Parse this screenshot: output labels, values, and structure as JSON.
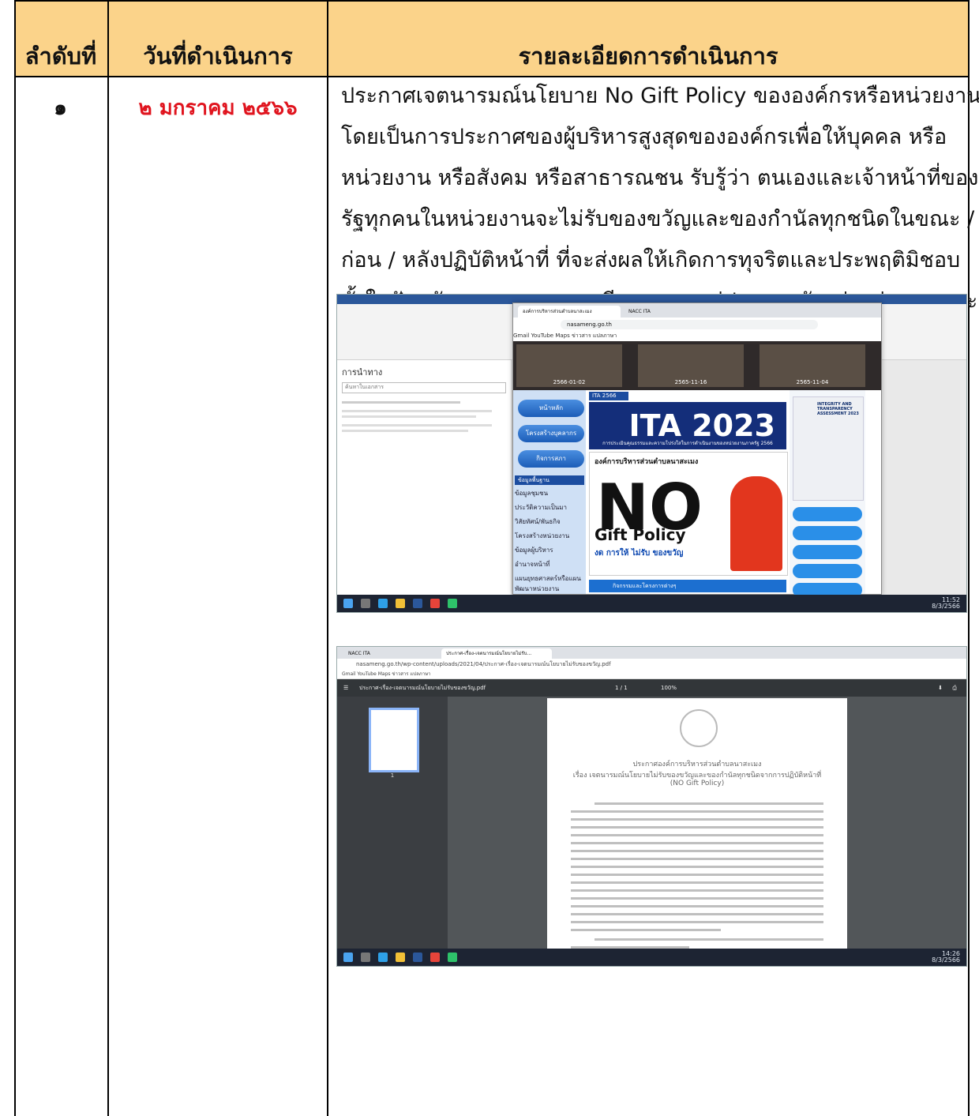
{
  "table": {
    "headers": [
      "ลำดับที่",
      "วันที่ดำเนินการ",
      "รายละเอียดการดำเนินการ"
    ],
    "header_color": "#fbd38a",
    "rows": [
      {
        "number": "๑",
        "date": "๒ มกราคม ๒๕๖๖",
        "date_color": "#e0141e",
        "details_lines": [
          "ประกาศเจตนารมณ์นโยบาย No Gift Policy ขององค์กรหรือหน่วยงาน",
          "โดยเป็นการประกาศของผู้บริหารสูงสุดขององค์กรเพื่อให้บุคคล หรือ",
          "หน่วยงาน หรือสังคม หรือสาธารณชน รับรู้ว่า ตนเองและเจ้าหน้าที่ของ",
          "รัฐทุกคนในหน่วยงานจะไม่รับของขวัญและของกำนัลทุกชนิดในขณะ /",
          "ก่อน / หลังปฏิบัติหน้าที่ ที่จะส่งผลให้เกิดการทุจริตและประพฤติมิชอบ",
          "ทั้งในปัจจุบันและอนาคตและมีการเผยแพร่ประกาศดังกล่าวสู่สาธารณะ"
        ]
      }
    ]
  },
  "screenshot1": {
    "word_nav_title": "การนำทาง",
    "word_nav_search": "ค้นหาในเอกสาร",
    "browser_tab_1": "องค์การบริหารส่วนตำบลนาสะเมง",
    "browser_tab_2": "NACC ITA",
    "address": "nasameng.go.th",
    "bookmarks": "Gmail   YouTube   Maps   ข่าวสาร   แปลภาษา",
    "news_dates": [
      "2566-01-02",
      "2565-11-16",
      "2565-11-04"
    ],
    "menu_buttons": [
      "หน้าหลัก",
      "โครงสร้างบุคลากร",
      "กิจการสภา"
    ],
    "menu_heading": "ข้อมูลพื้นฐาน",
    "menu_links": [
      "ข้อมูลชุมชน",
      "ประวัติความเป็นมา",
      "วิสัยทัศน์/พันธกิจ",
      "โครงสร้างหน่วยงาน",
      "ข้อมูลผู้บริหาร",
      "อำนาจหน้าที่",
      "แผนยุทธศาสตร์หรือแผนพัฒนาหน่วยงาน"
    ],
    "ita_label": "ITA 2566",
    "ita_title": "ITA 2023",
    "ita_sub": "การประเมินคุณธรรมและความโปร่งใสในการดำเนินงานของหน่วยงานภาครัฐ 2566",
    "org_name": "องค์การบริหารส่วนตำบลนาสะเมง",
    "gift_big": "NO",
    "gift_policy": "Gift Policy",
    "gift_sub": "งด การให้ ไม่รับ ของขวัญ",
    "poster_text": "INTEGRITY AND TRANSPARENCY ASSESSMENT 2023",
    "activity_bar": "กิจกรรมและโครงการต่างๆ",
    "clock_time": "11:52",
    "clock_date": "8/3/2566"
  },
  "screenshot2": {
    "tab_1": "NACC ITA",
    "tab_2": "ประกาศ-เรื่อง-เจตนารมณ์นโยบายไม่รับ...",
    "address": "nasameng.go.th/wp-content/uploads/2021/04/ประกาศ-เรื่อง-เจตนารมณ์นโยบายไม่รับของขวัญ.pdf",
    "bookmarks": "Gmail   YouTube   Maps   ข่าวสาร   แปลภาษา",
    "pdf_name": "ประกาศ-เรื่อง-เจตนารมณ์นโยบายไม่รับของขวัญ.pdf",
    "page_indicator": "1 / 1",
    "zoom": "100%",
    "thumb_label": "1",
    "doc_header": "ประกาศองค์การบริหารส่วนตำบลนาสะเมง",
    "doc_subject": "เรื่อง เจตนารมณ์นโยบายไม่รับของขวัญและของกำนัลทุกชนิดจากการปฏิบัติหน้าที่",
    "doc_subject2": "(NO Gift Policy)",
    "clock_time": "14:26",
    "clock_date": "8/3/2566"
  }
}
